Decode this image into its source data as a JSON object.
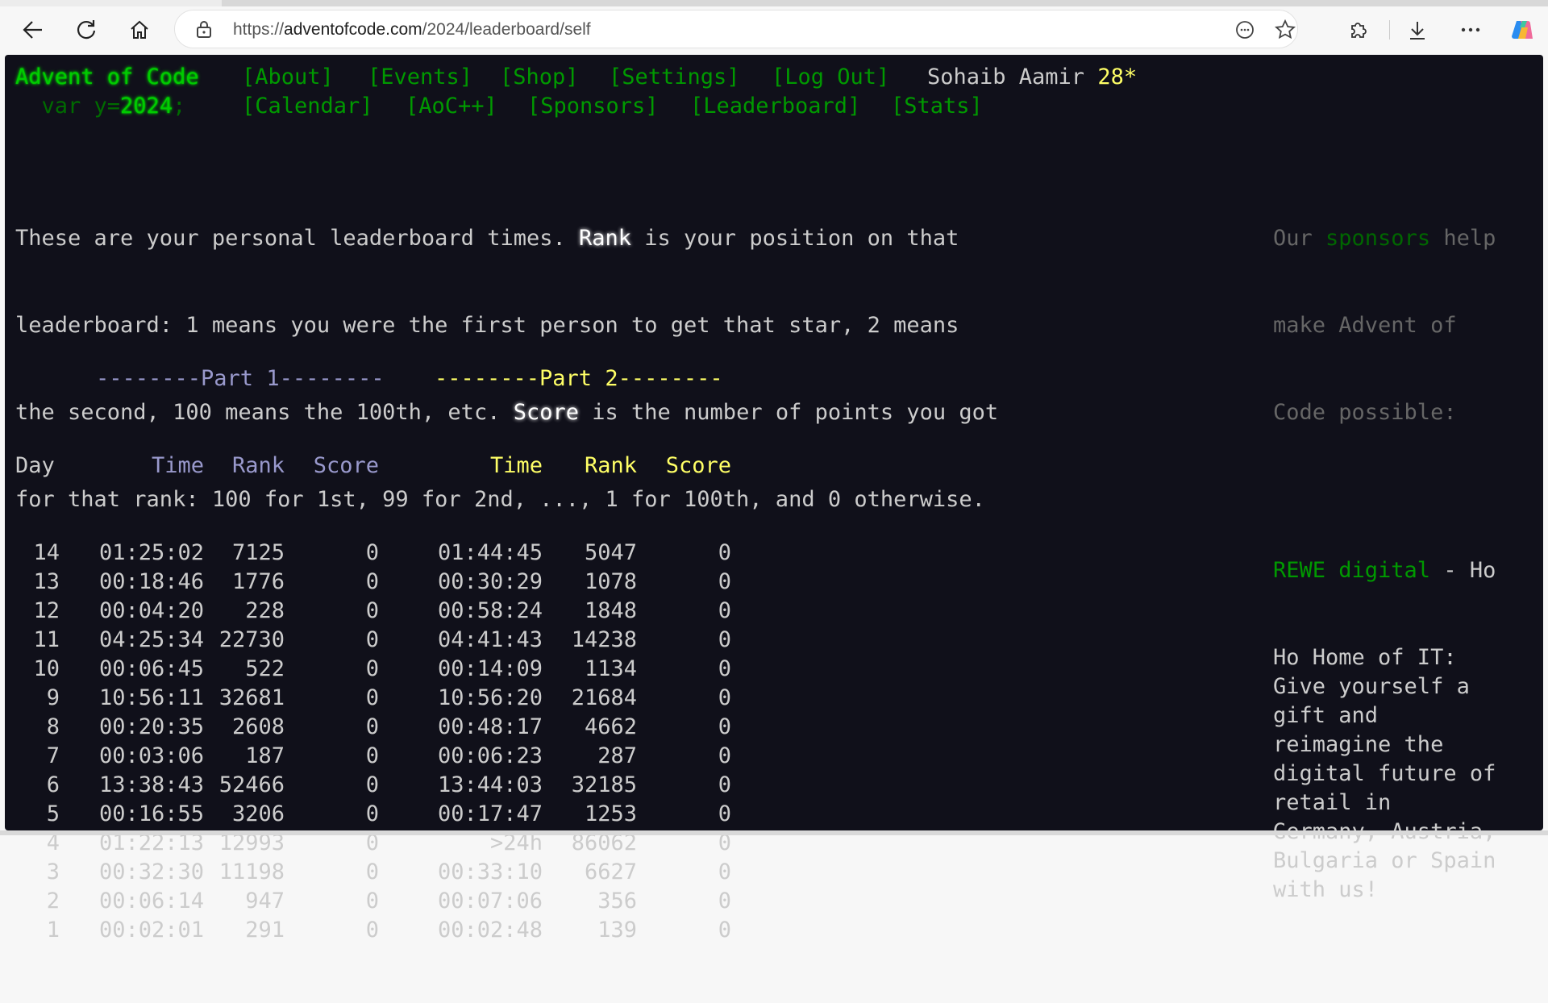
{
  "browser": {
    "url_prefix": "https://",
    "url_host": "adventofcode.com",
    "url_path": "/2024/leaderboard/self"
  },
  "site": {
    "title": "Advent of Code",
    "year_prefix": "  var y=",
    "year": "2024",
    "year_suffix": ";",
    "user_name": "Sohaib Aamir",
    "user_stars": "28*"
  },
  "nav_row1": [
    "[About]",
    "[Events]",
    "[Shop]",
    "[Settings]",
    "[Log Out]"
  ],
  "nav_row2": [
    "[Calendar]",
    "[AoC++]",
    "[Sponsors]",
    "[Leaderboard]",
    "[Stats]"
  ],
  "intro": {
    "l1a": "These are your personal leaderboard times. ",
    "l1b": "Rank",
    "l1c": " is your position on that",
    "l2": "leaderboard: 1 means you were the first person to get that star, 2 means",
    "l3a": "the second, 100 means the 100th, etc. ",
    "l3b": "Score",
    "l3c": " is the number of points you got",
    "l4": "for that rank: 100 for 1st, 99 for 2nd, ..., 1 for 100th, and 0 otherwise."
  },
  "table": {
    "part1_header": "--------Part 1--------",
    "part2_header": "--------Part 2--------",
    "col_day": "Day",
    "col_time": "Time",
    "col_rank": "Rank",
    "col_score": "Score",
    "rows": [
      {
        "day": "14",
        "t1": "01:25:02",
        "r1": "7125",
        "s1": "0",
        "t2": "01:44:45",
        "r2": "5047",
        "s2": "0"
      },
      {
        "day": "13",
        "t1": "00:18:46",
        "r1": "1776",
        "s1": "0",
        "t2": "00:30:29",
        "r2": "1078",
        "s2": "0"
      },
      {
        "day": "12",
        "t1": "00:04:20",
        "r1": "228",
        "s1": "0",
        "t2": "00:58:24",
        "r2": "1848",
        "s2": "0"
      },
      {
        "day": "11",
        "t1": "04:25:34",
        "r1": "22730",
        "s1": "0",
        "t2": "04:41:43",
        "r2": "14238",
        "s2": "0"
      },
      {
        "day": "10",
        "t1": "00:06:45",
        "r1": "522",
        "s1": "0",
        "t2": "00:14:09",
        "r2": "1134",
        "s2": "0"
      },
      {
        "day": "9",
        "t1": "10:56:11",
        "r1": "32681",
        "s1": "0",
        "t2": "10:56:20",
        "r2": "21684",
        "s2": "0"
      },
      {
        "day": "8",
        "t1": "00:20:35",
        "r1": "2608",
        "s1": "0",
        "t2": "00:48:17",
        "r2": "4662",
        "s2": "0"
      },
      {
        "day": "7",
        "t1": "00:03:06",
        "r1": "187",
        "s1": "0",
        "t2": "00:06:23",
        "r2": "287",
        "s2": "0"
      },
      {
        "day": "6",
        "t1": "13:38:43",
        "r1": "52466",
        "s1": "0",
        "t2": "13:44:03",
        "r2": "32185",
        "s2": "0"
      },
      {
        "day": "5",
        "t1": "00:16:55",
        "r1": "3206",
        "s1": "0",
        "t2": "00:17:47",
        "r2": "1253",
        "s2": "0"
      },
      {
        "day": "4",
        "t1": "01:22:13",
        "r1": "12993",
        "s1": "0",
        "t2": ">24h",
        "r2": "86062",
        "s2": "0"
      },
      {
        "day": "3",
        "t1": "00:32:30",
        "r1": "11198",
        "s1": "0",
        "t2": "00:33:10",
        "r2": "6627",
        "s2": "0"
      },
      {
        "day": "2",
        "t1": "00:06:14",
        "r1": "947",
        "s1": "0",
        "t2": "00:07:06",
        "r2": "356",
        "s2": "0"
      },
      {
        "day": "1",
        "t1": "00:02:01",
        "r1": "291",
        "s1": "0",
        "t2": "00:02:48",
        "r2": "139",
        "s2": "0"
      }
    ]
  },
  "sponsor": {
    "l1a": "Our ",
    "l1b": "sponsors",
    "l1c": " help",
    "l2": "make Advent of",
    "l3": "Code possible:",
    "link": "REWE digital",
    "l4rest": " - Ho",
    "lines": [
      "Ho Home of IT:",
      "Give yourself a",
      "gift and",
      "reimagine the",
      "digital future of",
      "retail in",
      "Germany, Austria,",
      "Bulgaria or Spain",
      "with us!"
    ]
  }
}
